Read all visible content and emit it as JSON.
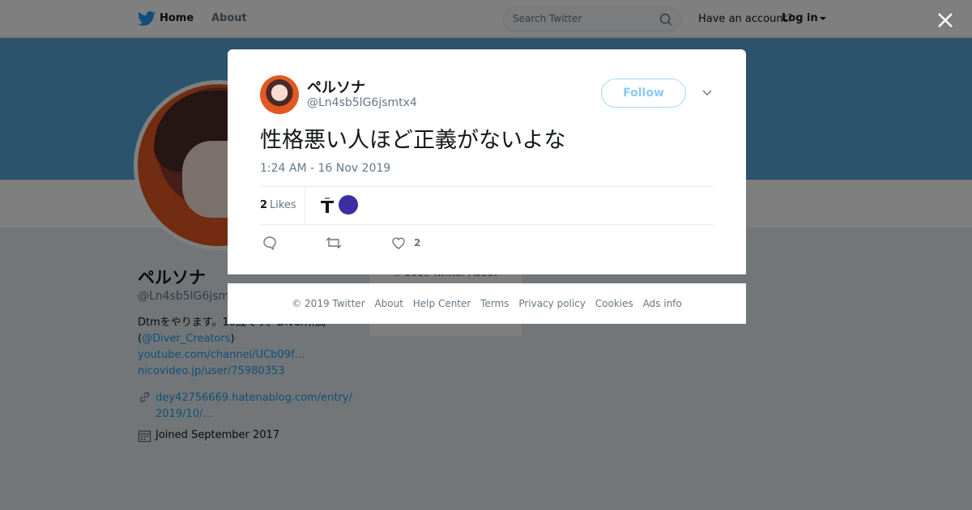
{
  "topbar": {
    "home_label": "Home",
    "about_label": "About",
    "search_placeholder": "Search Twitter",
    "account_question": "Have an account?",
    "login_label": "Log in"
  },
  "profile": {
    "name": "ペルソナ",
    "handle": "@Ln4sb5lG6jsmt",
    "bio_line1": "Dtmをやります。16歳です。Diver所属",
    "bio_mention_open": "(",
    "bio_mention": "@Diver_Creators",
    "bio_mention_close": ")",
    "bio_link1": "youtube.com/channel/UCb09f…",
    "bio_link2": "nicovideo.jp/user/75980353",
    "website_line1": "dey42756669.hatenablog.com/entry/",
    "website_line2": "2019/10/…",
    "joined": "Joined September 2017"
  },
  "side_card": {
    "text": "© 2019 Twitter  About"
  },
  "modal": {
    "name": "ペルソナ",
    "handle": "@Ln4sb5lG6jsmtx4",
    "follow_label": "Follow",
    "tweet_text": "性格悪い人ほど正義がないよな",
    "timestamp": "1:24 AM - 16 Nov 2019",
    "likes_count": "2",
    "likes_label": "Likes",
    "like_action_count": "2"
  },
  "footer": {
    "links": [
      "© 2019 Twitter",
      "About",
      "Help Center",
      "Terms",
      "Privacy policy",
      "Cookies",
      "Ads info"
    ]
  },
  "icons": {
    "logo": "twitter-bird-icon",
    "search": "search-icon",
    "close": "close-icon",
    "chevron": "chevron-down-icon",
    "reply": "reply-icon",
    "retweet": "retweet-icon",
    "like": "heart-icon",
    "link": "link-icon",
    "calendar": "calendar-icon"
  },
  "colors": {
    "brand": "#1da1f2",
    "banner": "#59a6d8",
    "muted": "#657786"
  }
}
